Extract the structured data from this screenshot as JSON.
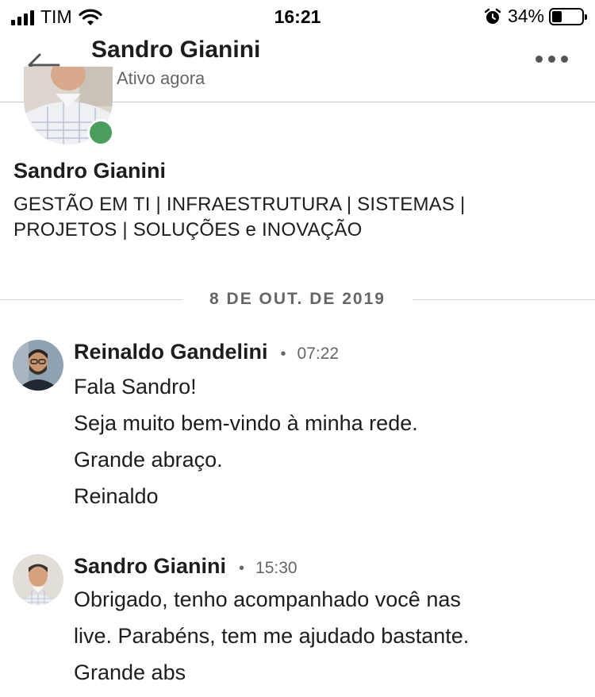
{
  "status_bar": {
    "carrier": "TIM",
    "time": "16:21",
    "battery": "34%",
    "battery_level": 0.34
  },
  "header": {
    "title": "Sandro Gianini",
    "presence": "Ativo agora",
    "presence_color": "#4a9e5c"
  },
  "profile": {
    "name": "Sandro Gianini",
    "headline_line1": "GESTÃO EM TI | INFRAESTRUTURA | SISTEMAS |",
    "headline_line2": "PROJETOS | SOLUÇÕES e INOVAÇÃO"
  },
  "date_divider": "8 DE OUT. DE 2019",
  "messages": [
    {
      "sender": "Reinaldo Gandelini",
      "time": "07:22",
      "lines": [
        "Fala Sandro!",
        "Seja muito bem-vindo à minha rede.",
        "Grande abraço.",
        "Reinaldo"
      ]
    },
    {
      "sender": "Sandro Gianini",
      "time": "15:30",
      "lines": [
        "Obrigado, tenho acompanhado você nas",
        "live.  Parabéns, tem me ajudado bastante.",
        "Grande abs"
      ]
    }
  ],
  "icons": {
    "back": "arrow-left-icon",
    "more": "more-horizontal-icon",
    "wifi": "wifi-icon",
    "alarm": "alarm-icon",
    "signal": "signal-icon",
    "battery": "battery-icon"
  }
}
